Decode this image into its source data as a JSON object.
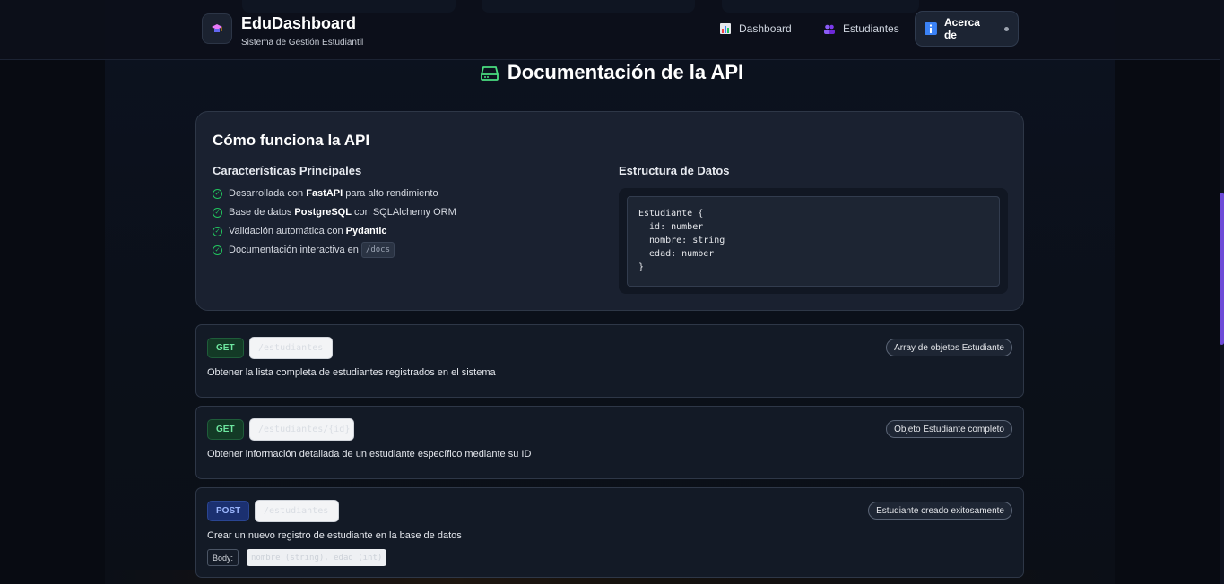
{
  "header": {
    "app_title": "EduDashboard",
    "app_subtitle": "Sistema de Gestión Estudiantil",
    "nav": [
      {
        "label": "Dashboard",
        "icon": "bar-chart-icon"
      },
      {
        "label": "Estudiantes",
        "icon": "users-icon"
      },
      {
        "label": "Acerca de",
        "icon": "info-icon",
        "active": true
      }
    ]
  },
  "page": {
    "title": "Documentación de la API",
    "title_icon": "database-icon"
  },
  "info": {
    "title": "Cómo funciona la API",
    "features_title": "Características Principales",
    "features": [
      {
        "pre": "Desarrollada con ",
        "bold": "FastAPI",
        "post": " para alto rendimiento"
      },
      {
        "pre": "Base de datos ",
        "bold": "PostgreSQL",
        "post": " con SQLAlchemy ORM"
      },
      {
        "pre": "Validación automática con ",
        "bold": "Pydantic",
        "post": ""
      },
      {
        "pre": "Documentación interactiva en ",
        "code": "/docs"
      }
    ],
    "structure_title": "Estructura de Datos",
    "code_lines": [
      "Estudiante {",
      "  id: number",
      "  nombre: string",
      "  edad: number",
      "}"
    ]
  },
  "endpoints": [
    {
      "method": "GET",
      "path": "/estudiantes",
      "returns": "Array de objetos Estudiante",
      "description": "Obtener la lista completa de estudiantes registrados en el sistema"
    },
    {
      "method": "GET",
      "path": "/estudiantes/{id}",
      "returns": "Objeto Estudiante completo",
      "description": "Obtener información detallada de un estudiante específico mediante su ID"
    },
    {
      "method": "POST",
      "path": "/estudiantes",
      "returns": "Estudiante creado exitosamente",
      "description": "Crear un nuevo registro de estudiante en la base de datos",
      "body_label": "Body:",
      "body": "nombre (string), edad (int)"
    }
  ],
  "colors": {
    "accent": "#22c55e",
    "post": "#1b3070",
    "get": "#133a26"
  }
}
